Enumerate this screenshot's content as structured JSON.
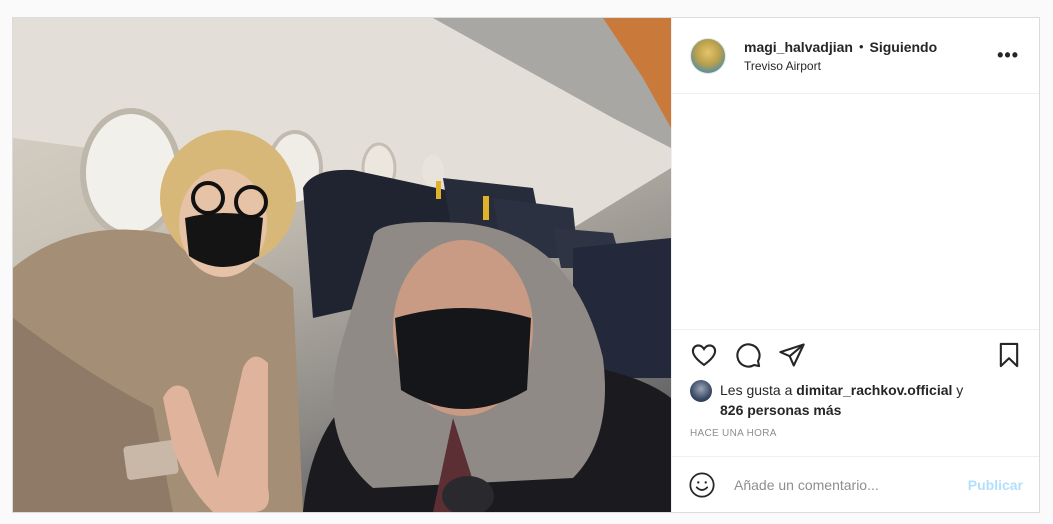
{
  "post": {
    "photo_alt": "",
    "header": {
      "username": "magi_halvadjian",
      "separator": "•",
      "follow_status": "Siguiendo",
      "location": "Treviso Airport",
      "more_label": "•••"
    },
    "actions": {
      "icons": [
        "heart-icon",
        "comment-icon",
        "share-icon",
        "bookmark-icon"
      ]
    },
    "likes": {
      "prefix": "Les gusta a ",
      "liked_by": "dimitar_rachkov.official",
      "connector": " y",
      "others": "826 personas más"
    },
    "time_ago": "HACE UNA HORA",
    "comment": {
      "placeholder": "Añade un comentario...",
      "value": "",
      "publish_label": "Publicar"
    }
  },
  "colors": {
    "border": "#dbdbdb",
    "publish_disabled": "#b2dffc",
    "muted": "#8e8e8e",
    "text": "#262626"
  }
}
